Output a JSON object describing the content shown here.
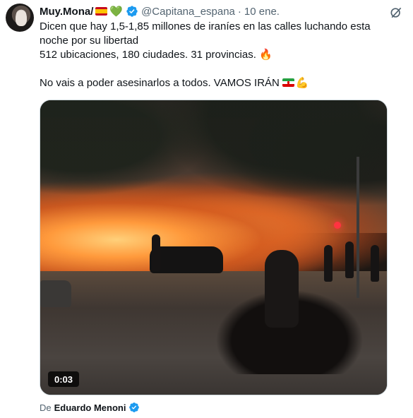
{
  "tweet": {
    "author": {
      "display_name": "Muy.Mona/",
      "emoji_flag": "spain-flag-icon",
      "emoji_heart": "💚",
      "handle": "@Capitana_espana",
      "separator": "·",
      "date": "10 ene."
    },
    "text": {
      "line1": "Dicen que hay 1,5-1,85 millones de iraníes en las calles luchando esta noche por su libertad",
      "line2": "512 ubicaciones, 180 ciudades. 31 provincias.",
      "line2_emoji": "🔥",
      "line3": "No vais a poder asesinarlos a todos. VAMOS IRÁN",
      "line3_emoji_flag": "iran-flag-icon",
      "line3_emoji_muscle": "💪"
    },
    "media": {
      "type": "video",
      "duration": "0:03"
    },
    "source": {
      "prefix": "De",
      "name": "Eduardo Menoni"
    }
  },
  "colors": {
    "verified_blue": "#1d9bf0",
    "text_primary": "#0f1419",
    "text_secondary": "#536471",
    "border": "#cfd9de"
  }
}
